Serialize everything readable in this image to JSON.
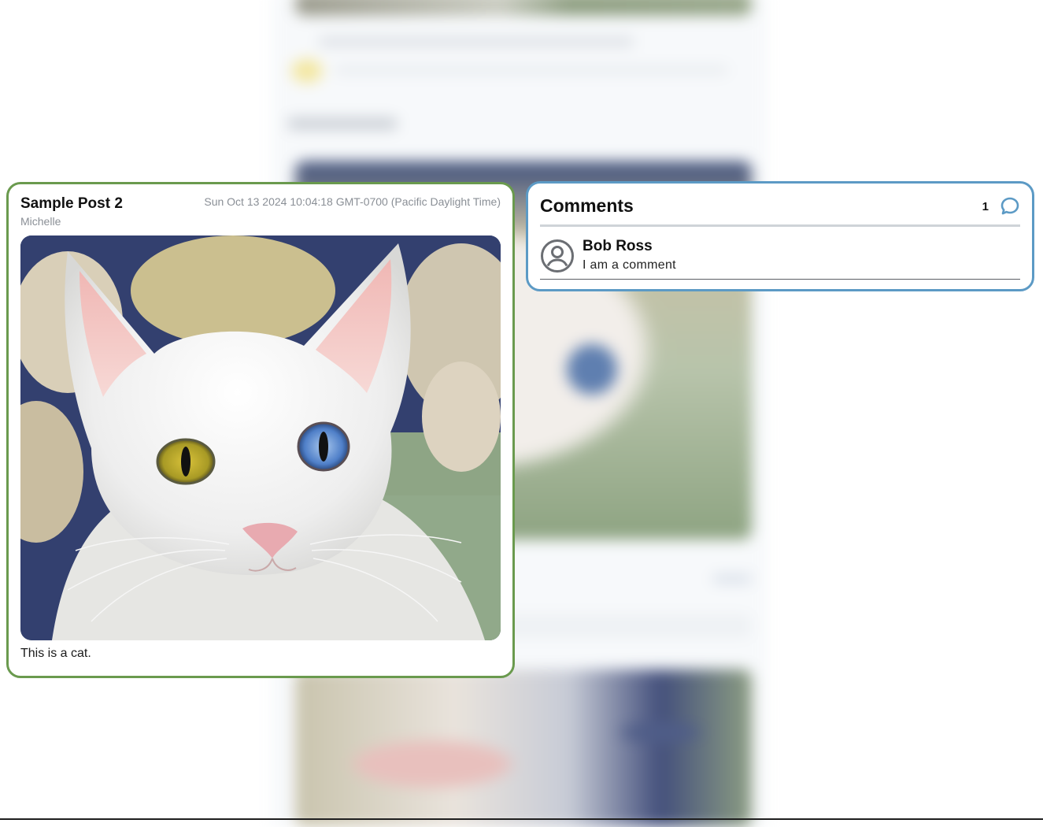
{
  "post": {
    "title": "Sample Post 2",
    "author": "Michelle",
    "timestamp": "Sun Oct 13 2024 10:04:18 GMT-0700 (Pacific Daylight Time)",
    "image_description": "white-cat-photo",
    "caption": "This is a cat."
  },
  "comments": {
    "title": "Comments",
    "count": "1",
    "items": [
      {
        "author": "Bob Ross",
        "text": "I am a comment"
      }
    ]
  },
  "colors": {
    "post_border": "#6a9a4e",
    "comments_border": "#5c9ac5",
    "comment_icon": "#5c9ac5",
    "muted_text": "#8a8f96"
  },
  "icons": {
    "comment": "speech-bubble-icon",
    "avatar": "user-circle-icon"
  }
}
